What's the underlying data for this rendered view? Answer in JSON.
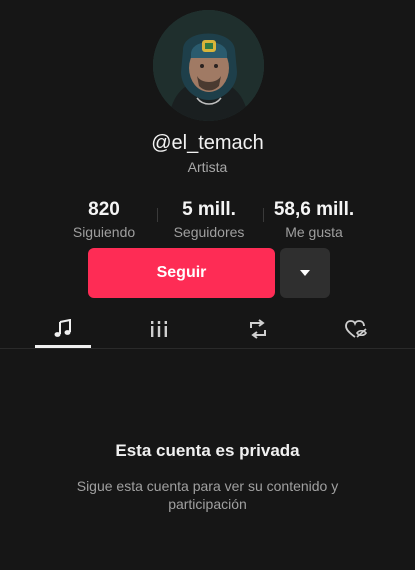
{
  "profile": {
    "username": "@el_temach",
    "category": "Artista"
  },
  "stats": [
    {
      "value": "820",
      "label": "Siguiendo"
    },
    {
      "value": "5 mill.",
      "label": "Seguidores"
    },
    {
      "value": "58,6 mill.",
      "label": "Me gusta"
    }
  ],
  "actions": {
    "follow_label": "Seguir",
    "more_icon": "caret-down-icon"
  },
  "tabs": [
    {
      "icon": "music-note-icon",
      "active": true
    },
    {
      "icon": "grid-bars-icon",
      "active": false
    },
    {
      "icon": "repost-icon",
      "active": false
    },
    {
      "icon": "liked-hidden-icon",
      "active": false
    }
  ],
  "private_notice": {
    "title": "Esta cuenta es privada",
    "description": "Sigue esta cuenta para ver su contenido y participación"
  },
  "colors": {
    "background": "#161616",
    "follow_button": "#fe2c55",
    "secondary_button": "#2f2f2f"
  }
}
